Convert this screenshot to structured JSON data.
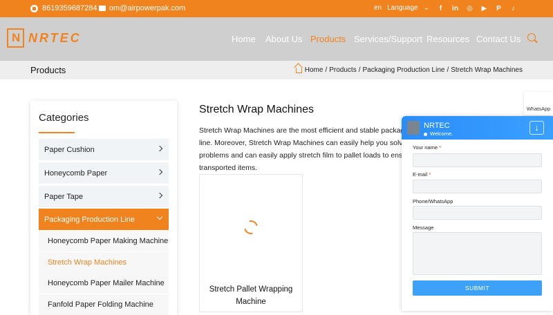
{
  "topbar": {
    "phone": "8619359687284",
    "email": "om@airpowerpak.com",
    "lang_code": "en",
    "language_label": "Language",
    "social": [
      "facebook-icon",
      "linkedin-icon",
      "instagram-icon",
      "youtube-icon",
      "pinterest-icon",
      "tiktok-icon"
    ]
  },
  "header": {
    "logo_text": "NRTEC",
    "nav": [
      "Home",
      "About Us",
      "Products",
      "Services/Support",
      "Resources",
      "Contact Us"
    ],
    "active_nav": "Products"
  },
  "breadcrumb_bar": {
    "page_title": "Products",
    "crumbs": [
      "Home",
      "Products",
      "Packaging Production Line",
      "Stretch Wrap Machines"
    ]
  },
  "sidebar": {
    "title": "Categories",
    "items": [
      "Paper Cushion",
      "Honeycomb Paper",
      "Paper Tape",
      "Packaging Production Line"
    ],
    "sub_items": [
      "Honeycomb Paper Making Machine",
      "Stretch Wrap Machines",
      "Honeycomb Paper Mailer Machine",
      "Fanfold Paper Folding Machine"
    ]
  },
  "main": {
    "title": "Stretch Wrap Machines",
    "desc_lines": [
      "Stretch Wrap Machines are the most efficient and stable packaging",
      "line. Moreover, Stretch Wrap Machines can easily help you solve p",
      "problems and can easily apply stretch film to pallet loads to ensure",
      "transported items."
    ],
    "card_title": "Stretch Pallet Wrapping Machine"
  },
  "whatsapp_tab": "WhatsApp",
  "chat": {
    "name": "NRTEC",
    "status": "Welcome.",
    "fields": [
      "Your name",
      "E-mail",
      "Phone/WhatsApp",
      "Message"
    ],
    "required_mark": "*",
    "submit": "SUBMIT"
  },
  "colors": {
    "accent": "#f0831e",
    "chat_blue": "#3ca1f7"
  }
}
